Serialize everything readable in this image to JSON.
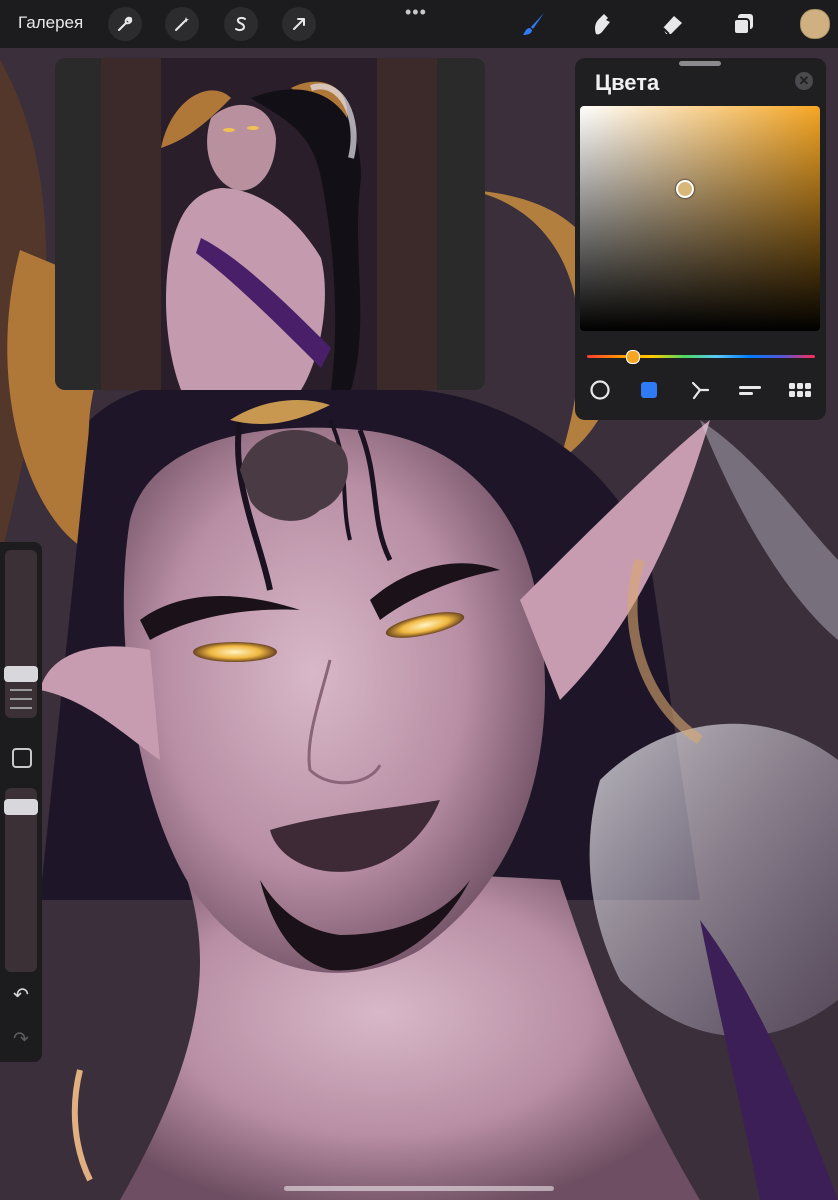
{
  "toolbar": {
    "gallery_label": "Галерея",
    "more_dots": "•••",
    "left_tools": [
      "wrench-icon",
      "magic-wand-icon",
      "selection-s-icon",
      "transform-arrow-icon"
    ],
    "right_tools": [
      "brush-icon",
      "smudge-icon",
      "eraser-icon",
      "layers-icon"
    ],
    "active_tool": "brush-icon",
    "current_color": "#d0b080"
  },
  "reference_window": {
    "content": "reference-artwork-thumbnail"
  },
  "colors_panel": {
    "title": "Цвета",
    "close_glyph": "✕",
    "hue_color": "#f5a623",
    "modes": [
      "disc-mode",
      "classic-mode",
      "harmony-mode",
      "value-mode",
      "palettes-mode"
    ],
    "active_mode": "classic-mode"
  },
  "sidebar": {
    "undo_glyph": "↶",
    "redo_glyph": "↷"
  },
  "colors": {
    "accent": "#2f7af5",
    "toolbar_bg": "#1c1c1e"
  }
}
